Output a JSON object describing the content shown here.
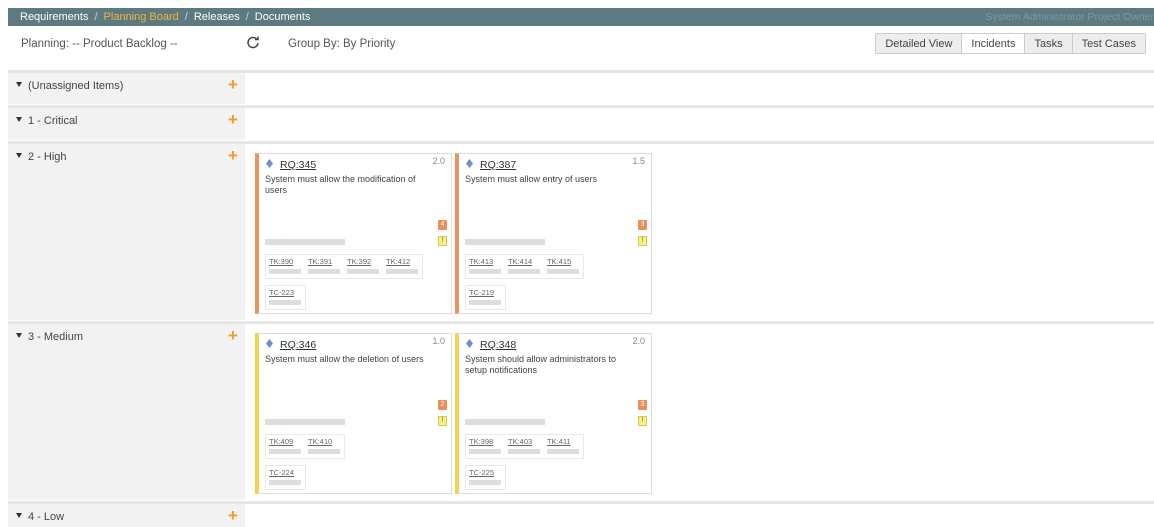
{
  "nav": {
    "items": [
      "Requirements",
      "Planning Board",
      "Releases",
      "Documents"
    ],
    "separator": "/",
    "user": "System Administrator  Project Owner"
  },
  "toolbar": {
    "planning_label": "Planning:  -- Product Backlog --",
    "groupby_label": "Group By:  By Priority",
    "views": [
      "Detailed View",
      "Incidents",
      "Tasks",
      "Test Cases"
    ]
  },
  "rows": [
    {
      "title": "(Unassigned Items)"
    },
    {
      "title": "1 - Critical"
    },
    {
      "title": "2 - High"
    },
    {
      "title": "3 - Medium"
    },
    {
      "title": "4 - Low"
    }
  ],
  "cards": [
    {
      "id": "RQ:345",
      "estimate": "2.0",
      "description": "System must allow the modification of users",
      "incident_count": "4",
      "warning": "!",
      "tasks": [
        "TK:390",
        "TK:391",
        "TK:392",
        "TK:412"
      ],
      "tests": [
        "TC-223"
      ]
    },
    {
      "id": "RQ:387",
      "estimate": "1.5",
      "description": "System must allow entry of users",
      "incident_count": "3",
      "warning": "!",
      "tasks": [
        "TK:413",
        "TK:414",
        "TK:415"
      ],
      "tests": [
        "TC-219"
      ]
    },
    {
      "id": "RQ:346",
      "estimate": "1.0",
      "description": "System must allow the deletion of users",
      "incident_count": "2",
      "warning": "!",
      "tasks": [
        "TK:409",
        "TK:410"
      ],
      "tests": [
        "TC-224"
      ]
    },
    {
      "id": "RQ:348",
      "estimate": "2.0",
      "description": "System should allow administrators to setup notifications",
      "incident_count": "3",
      "warning": "!",
      "tasks": [
        "TK:398",
        "TK:403",
        "TK:411"
      ],
      "tests": [
        "TC-225"
      ]
    }
  ],
  "colors": {
    "nav_bg": "#5d7a80",
    "nav_active": "#f5b33a",
    "add_icon": "#f39a2c",
    "priority_high": "#ea9460",
    "priority_medium": "#f1d24c"
  },
  "icons": {
    "refresh": "refresh-icon",
    "add": "plus-icon",
    "expand": "caret-down-icon",
    "requirement": "diamond-icon"
  }
}
